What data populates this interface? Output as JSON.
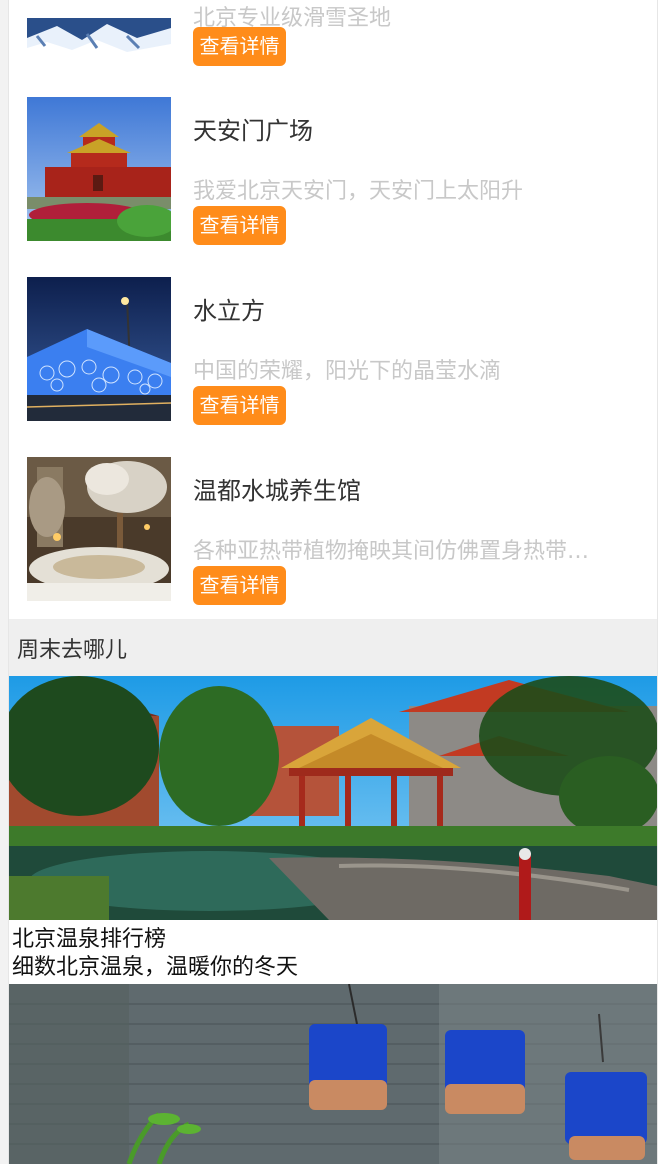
{
  "attractions": [
    {
      "title": "",
      "desc": "北京专业级滑雪圣地",
      "button": "查看详情",
      "image": "snow-landscape"
    },
    {
      "title": "天安门广场",
      "desc": "我爱北京天安门，天安门上太阳升",
      "button": "查看详情",
      "image": "tiananmen-gate"
    },
    {
      "title": "水立方",
      "desc": "中国的荣耀，阳光下的晶莹水滴",
      "button": "查看详情",
      "image": "water-cube"
    },
    {
      "title": "温都水城养生馆",
      "desc": "各种亚热带植物掩映其间仿佛置身热带…",
      "button": "查看详情",
      "image": "hot-spring-hall"
    }
  ],
  "section": {
    "title": "周末去哪儿"
  },
  "banners": [
    {
      "title": "北京温泉排行榜",
      "subtitle": "细数北京温泉，温暖你的冬天",
      "image": "garden-pavilion"
    },
    {
      "title": "",
      "subtitle": "",
      "image": "hutong-birdcages"
    }
  ],
  "colors": {
    "button": "#ff8c1a",
    "desc": "#c8c8c8",
    "section_bg": "#efefef"
  }
}
